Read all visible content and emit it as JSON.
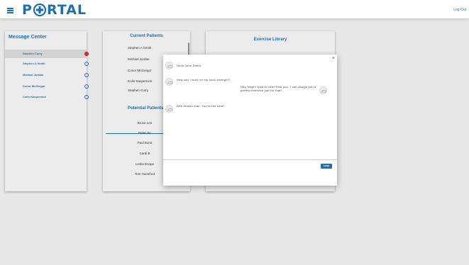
{
  "colors": {
    "brand": "#1c6fb5",
    "unread": "#d62e2e"
  },
  "appbar": {
    "logo_p": "P",
    "logo_rest": "RTAL",
    "logout": "Log Out"
  },
  "message_center": {
    "title": "Message Center",
    "items": [
      {
        "label": "Stephen Curry",
        "active": true,
        "unread": true
      },
      {
        "label": "Stephen A Smith",
        "active": false,
        "unread": false
      },
      {
        "label": "Michael Jordan",
        "active": false,
        "unread": false
      },
      {
        "label": "Conor McGregor",
        "active": false,
        "unread": false
      },
      {
        "label": "Colin Kaepernick",
        "active": false,
        "unread": false
      }
    ]
  },
  "current_patients": {
    "title": "Current Patients",
    "items": [
      "Stephen A Smith",
      "Michael Jordan",
      "Conor McGregor",
      "Colin Kaepernick",
      "Stephen Curry"
    ]
  },
  "potential_patients": {
    "title": "Potential Patients",
    "items": [
      "Bruce Lee",
      "Peter Hu",
      "Paul Borst",
      "Cardi B",
      "Leslie Knope",
      "Tom Hansford"
    ]
  },
  "exercise_library": {
    "title": "Exercise Library"
  },
  "chat": {
    "close": "×",
    "messages": [
      {
        "side": "left",
        "text": "Hello John Smith"
      },
      {
        "side": "left",
        "text": "How can I work on my back strength?"
      },
      {
        "side": "right",
        "text": "Hey Steph! Nice to hear from you. I can assign you a perfect exercise just for that!"
      },
      {
        "side": "left",
        "text": "Gee thanks man. You're the best!"
      }
    ],
    "input_value": "",
    "input_placeholder": "",
    "send": "SEND"
  }
}
